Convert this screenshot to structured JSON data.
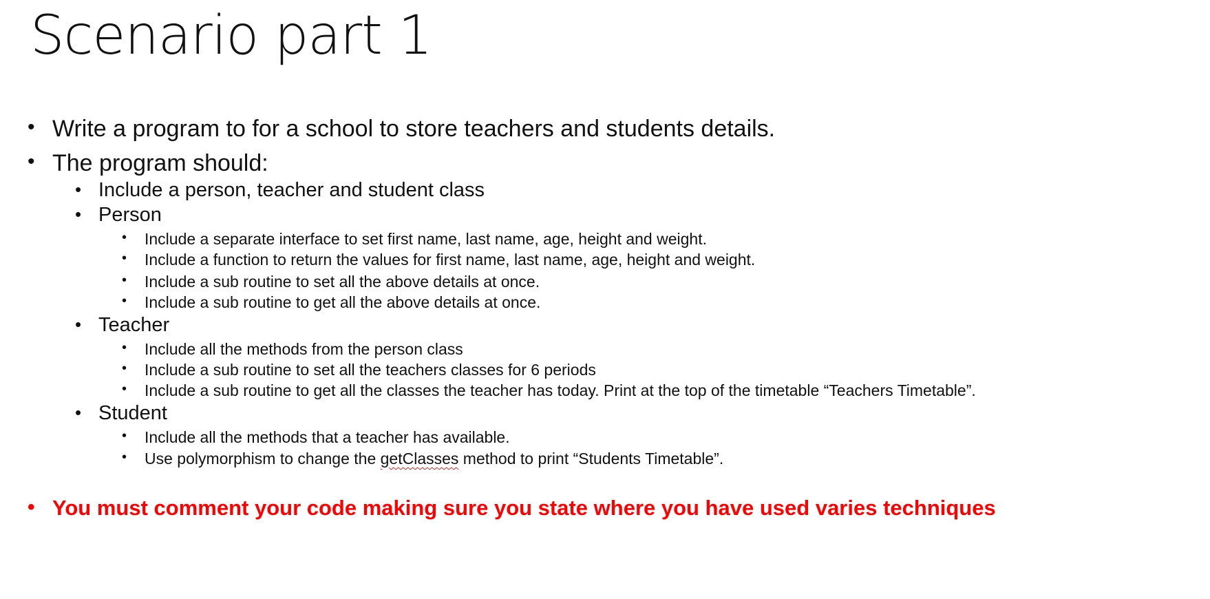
{
  "slide": {
    "title": "Scenario part 1",
    "bullet_glyph": "•",
    "items": [
      {
        "level": 1,
        "text": "Write a program to for a school to store teachers and students details."
      },
      {
        "level": 1,
        "text": "The program should:"
      },
      {
        "level": 2,
        "text": "Include a person, teacher and student class"
      },
      {
        "level": 2,
        "text": "Person"
      },
      {
        "level": 3,
        "text": "Include a separate interface to set first name, last name, age, height and weight."
      },
      {
        "level": 3,
        "text": "Include a function to return the values for first name, last name, age, height and weight."
      },
      {
        "level": 3,
        "text": "Include a sub routine to set all the above details at once."
      },
      {
        "level": 3,
        "text": "Include a sub routine to get all the above details at once."
      },
      {
        "level": 2,
        "text": "Teacher"
      },
      {
        "level": 3,
        "text": "Include all the methods from the person class"
      },
      {
        "level": 3,
        "text": "Include a sub routine to set all the teachers classes for 6 periods"
      },
      {
        "level": 3,
        "text": "Include a sub routine to get all the classes the teacher has today. Print at the top of the timetable “Teachers Timetable”."
      },
      {
        "level": 2,
        "text": "Student"
      },
      {
        "level": 3,
        "text": "Include all the methods that a teacher has available."
      },
      {
        "level": 3,
        "text_before": "Use polymorphism to change the ",
        "text_flagged": "getClasses",
        "text_after": " method to print “Students Timetable”."
      },
      {
        "level": 1,
        "text": "You must comment your code making sure you state where you have used varies techniques",
        "emphasis": "red-bold"
      }
    ],
    "colors": {
      "text": "#111111",
      "emphasis": "#ff0000",
      "spellcheck_underline": "#e02020"
    }
  }
}
